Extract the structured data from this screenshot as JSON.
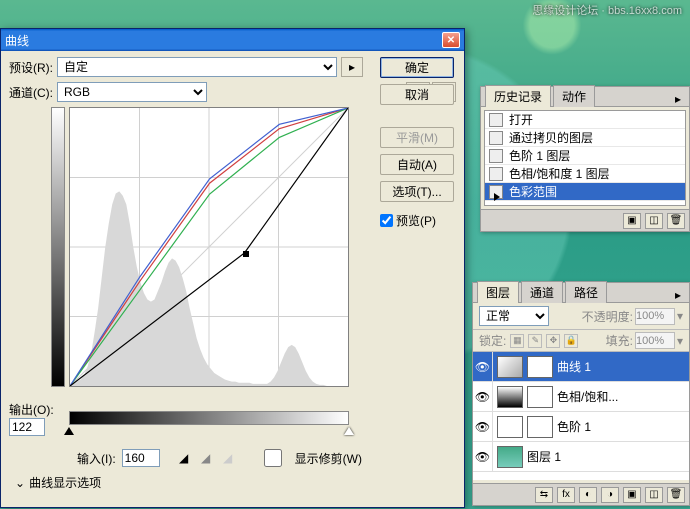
{
  "watermark": "思缘设计论坛 · bbs.16xx8.com",
  "dialog": {
    "title": "曲线",
    "preset_label": "预设(R):",
    "preset_value": "自定",
    "channel_label": "通道(C):",
    "channel_value": "RGB",
    "output_label": "输出(O):",
    "output_value": "122",
    "input_label": "输入(I):",
    "input_value": "160",
    "show_clipping": "显示修剪(W)",
    "disclosure": "曲线显示选项",
    "buttons": {
      "ok": "确定",
      "cancel": "取消",
      "smooth": "平滑(M)",
      "auto": "自动(A)",
      "options": "选项(T)..."
    },
    "preview": "预览(P)"
  },
  "history": {
    "tabs": [
      "历史记录",
      "动作"
    ],
    "items": [
      "打开",
      "通过拷贝的图层",
      "色阶 1 图层",
      "色相/饱和度 1 图层",
      "色彩范围"
    ]
  },
  "layers": {
    "tabs": [
      "图层",
      "通道",
      "路径"
    ],
    "blend": "正常",
    "opacity_label": "不透明度:",
    "opacity_value": "100%",
    "lock_label": "锁定:",
    "fill_label": "填充:",
    "fill_value": "100%",
    "rows": [
      "曲线 1",
      "色相/饱和...",
      "色阶 1",
      "图层 1"
    ]
  },
  "chart_data": {
    "type": "line",
    "title": "Curves",
    "xlabel": "Input",
    "ylabel": "Output",
    "xlim": [
      0,
      255
    ],
    "ylim": [
      0,
      255
    ],
    "selected_point": {
      "input": 160,
      "output": 122
    },
    "series": [
      {
        "name": "Red",
        "color": "#d04040",
        "points": [
          [
            0,
            0
          ],
          [
            64,
            96
          ],
          [
            128,
            186
          ],
          [
            192,
            236
          ],
          [
            255,
            255
          ]
        ]
      },
      {
        "name": "Green",
        "color": "#30b050",
        "points": [
          [
            0,
            0
          ],
          [
            64,
            88
          ],
          [
            128,
            176
          ],
          [
            192,
            228
          ],
          [
            255,
            255
          ]
        ]
      },
      {
        "name": "Blue",
        "color": "#4060d0",
        "points": [
          [
            0,
            0
          ],
          [
            64,
            100
          ],
          [
            128,
            190
          ],
          [
            192,
            240
          ],
          [
            255,
            255
          ]
        ]
      },
      {
        "name": "RGB",
        "color": "#000000",
        "points": [
          [
            0,
            0
          ],
          [
            160,
            122
          ],
          [
            255,
            255
          ]
        ]
      }
    ],
    "histogram": [
      0,
      2,
      4,
      6,
      10,
      18,
      30,
      50,
      72,
      100,
      128,
      150,
      168,
      178,
      180,
      176,
      168,
      150,
      128,
      110,
      96,
      86,
      80,
      78,
      80,
      88,
      96,
      106,
      114,
      118,
      116,
      110,
      100,
      88,
      72,
      58,
      44,
      34,
      26,
      20,
      16,
      12,
      10,
      8,
      6,
      5,
      4,
      4,
      3,
      3,
      3,
      3,
      2,
      2,
      2,
      2,
      2,
      4,
      8,
      14,
      22,
      30,
      36,
      38,
      36,
      30,
      22,
      14,
      8,
      4,
      2,
      1,
      1,
      0,
      0,
      0,
      0,
      0,
      0,
      0
    ]
  }
}
